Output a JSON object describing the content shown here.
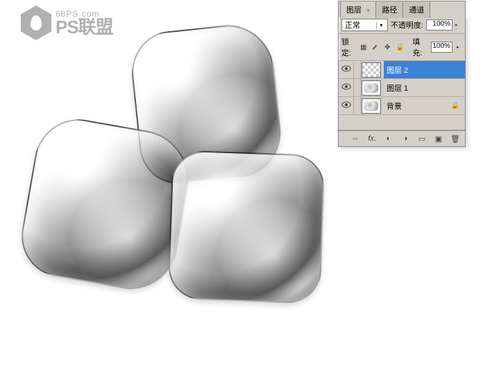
{
  "watermark": {
    "url": "68PS.com",
    "brand": "PS联盟"
  },
  "panel": {
    "tabs": [
      {
        "label": "图层",
        "active": true
      },
      {
        "label": "路径",
        "active": false
      },
      {
        "label": "通道",
        "active": false
      }
    ],
    "blend_mode_label": "正常",
    "opacity_label": "不透明度:",
    "opacity_value": "100%",
    "lock_label": "锁定:",
    "fill_label": "填充:",
    "fill_value": "100%",
    "layers": [
      {
        "name": "图层 2",
        "selected": true,
        "locked": false,
        "thumb": "checker"
      },
      {
        "name": "图层 1",
        "selected": false,
        "locked": false,
        "thumb": "ice"
      },
      {
        "name": "背景",
        "selected": false,
        "locked": true,
        "thumb": "ice"
      }
    ]
  }
}
